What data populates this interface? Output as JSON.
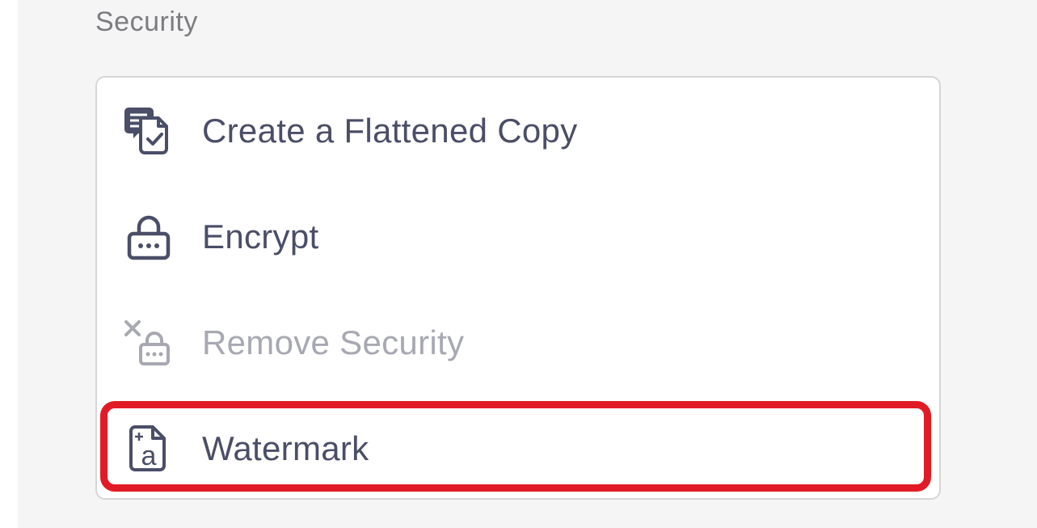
{
  "section": {
    "title": "Security"
  },
  "menu": {
    "items": [
      {
        "label": "Create a Flattened Copy",
        "icon": "flattened-copy-icon",
        "enabled": true
      },
      {
        "label": "Encrypt",
        "icon": "lock-icon",
        "enabled": true
      },
      {
        "label": "Remove Security",
        "icon": "remove-lock-icon",
        "enabled": false
      },
      {
        "label": "Watermark",
        "icon": "watermark-icon",
        "enabled": true,
        "highlighted": true
      }
    ]
  },
  "colors": {
    "text": "#4a4e67",
    "disabled_text": "#a7a8b2",
    "section_title": "#7c7c80",
    "highlight": "#e11b25",
    "background": "#f5f5f5",
    "card": "#ffffff"
  }
}
